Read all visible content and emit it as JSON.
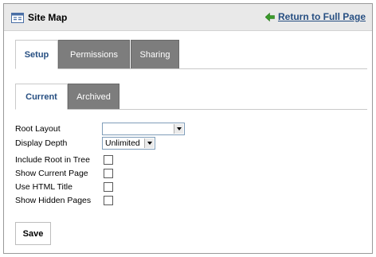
{
  "titlebar": {
    "icon": "sitemap-icon",
    "title": "Site Map",
    "return_icon": "green-back-arrow-icon",
    "return_label": "Return to Full Page"
  },
  "main_tabs": [
    {
      "label": "Setup",
      "active": true
    },
    {
      "label": "Permissions",
      "active": false
    },
    {
      "label": "Sharing",
      "active": false
    }
  ],
  "sub_tabs": [
    {
      "label": "Current",
      "active": true
    },
    {
      "label": "Archived",
      "active": false
    }
  ],
  "form": {
    "root_layout": {
      "label": "Root Layout",
      "value": ""
    },
    "display_depth": {
      "label": "Display Depth",
      "value": "Unlimited"
    },
    "include_root": {
      "label": "Include Root in Tree",
      "checked": false
    },
    "show_current": {
      "label": "Show Current Page",
      "checked": false
    },
    "use_html_title": {
      "label": "Use HTML Title",
      "checked": false
    },
    "show_hidden": {
      "label": "Show Hidden Pages",
      "checked": false
    }
  },
  "actions": {
    "save_label": "Save"
  },
  "colors": {
    "titlebar_bg": "#e9e9e9",
    "active_tab_text": "#274f82",
    "inactive_tab_bg": "#7d7d7d",
    "link": "#274f82",
    "arrow": "#3a9a2a"
  }
}
